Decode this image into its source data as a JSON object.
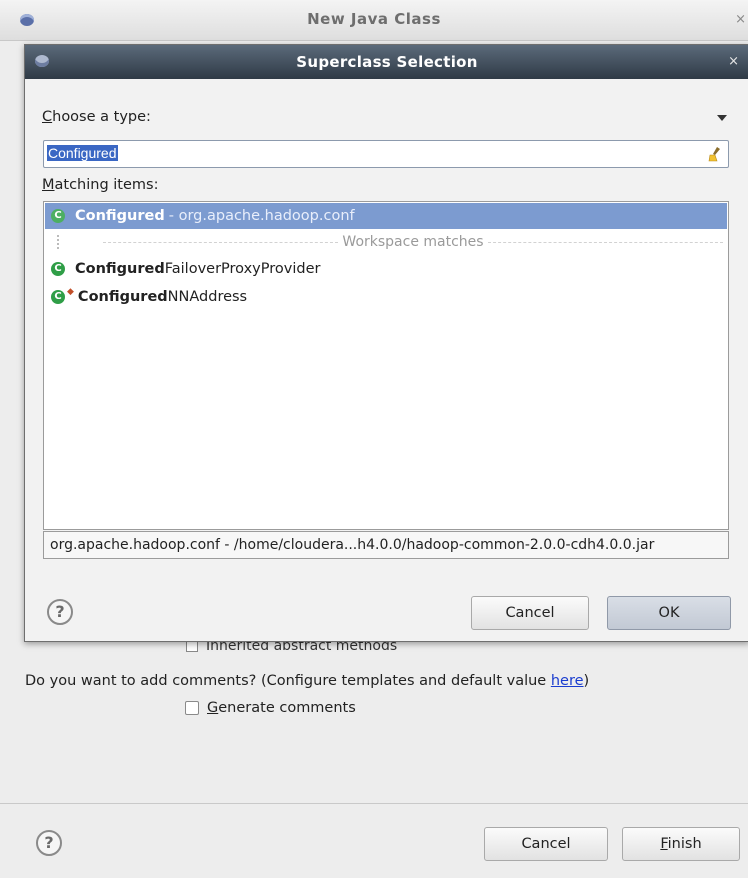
{
  "background_window": {
    "title": "New Java Class",
    "close_glyph": "×",
    "partial_text": "Inherited abstract methods",
    "comments_question_prefix": "Do you want to add comments? (Configure templates and default value ",
    "comments_link": "here",
    "comments_question_suffix": ")",
    "generate_comments_label_mnemonic": "G",
    "generate_comments_label_rest": "enerate comments",
    "help_glyph": "?",
    "cancel_label": "Cancel",
    "finish_label_mnemonic": "F",
    "finish_label_rest": "inish"
  },
  "dialog": {
    "title": "Superclass Selection",
    "close_glyph": "×",
    "choose_label_mnemonic": "C",
    "choose_label_rest": "hoose a type:",
    "search_value": "Configured",
    "matching_label_mnemonic": "M",
    "matching_label_rest": "atching items:",
    "items": [
      {
        "bold": "Configured",
        "rest": "",
        "qualifier": " - org.apache.hadoop.conf",
        "selected": true,
        "icon": "class-icon"
      },
      {
        "separator": "Workspace matches"
      },
      {
        "bold": "Configured",
        "rest": "FailoverProxyProvider",
        "icon": "class-icon"
      },
      {
        "bold": "Configured",
        "rest": "NNAddress",
        "icon": "class-icon-decorated"
      }
    ],
    "status_text": "org.apache.hadoop.conf - /home/cloudera...h4.0.0/hadoop-common-2.0.0-cdh4.0.0.jar",
    "help_glyph": "?",
    "cancel_label": "Cancel",
    "ok_label": "OK"
  }
}
